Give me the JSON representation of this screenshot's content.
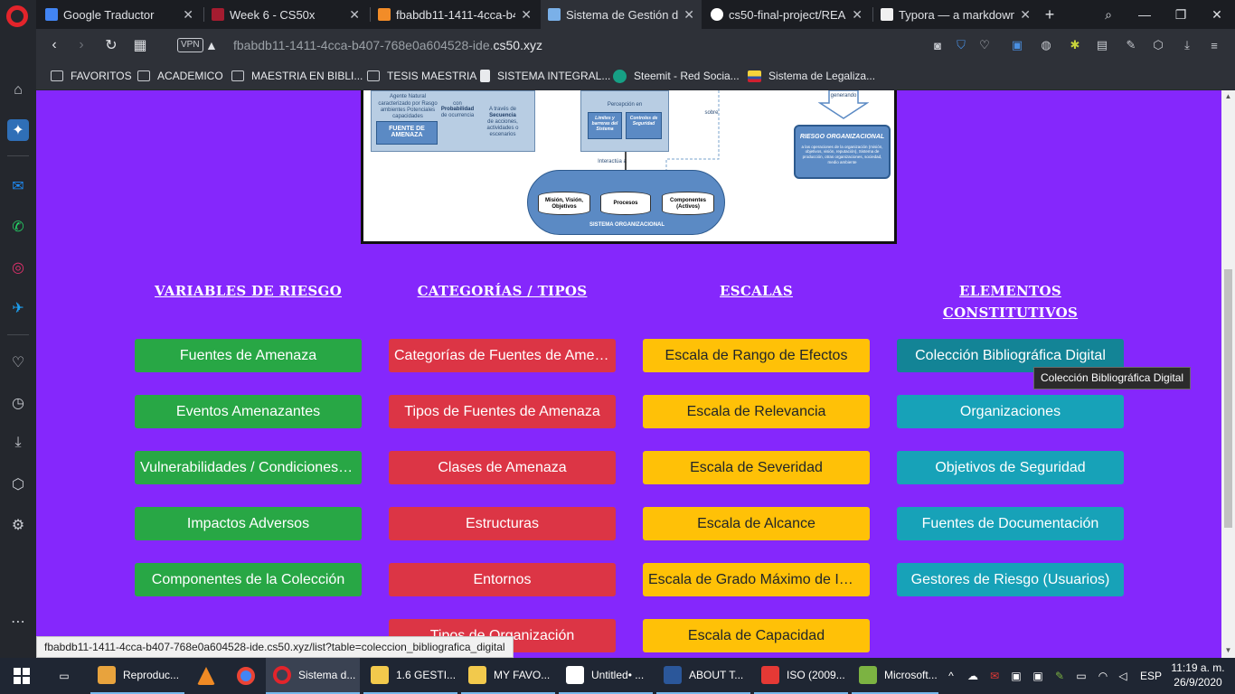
{
  "browser": {
    "tabs": [
      {
        "title": "Google Traductor",
        "favicon_color": "#4285f4"
      },
      {
        "title": "Week 6 - CS50x",
        "favicon_color": "#a51c30"
      },
      {
        "title": "fbabdb11-1411-4cca-b4",
        "favicon_color": "#f28c28"
      },
      {
        "title": "Sistema de Gestión de R",
        "favicon_color": "#7ab0e8"
      },
      {
        "title": "cs50-final-project/READI",
        "favicon_color": "#ffffff"
      },
      {
        "title": "Typora — a markdown e",
        "favicon_color": "#f0f0f0"
      }
    ],
    "new_tab_symbol": "+",
    "vpn_label": "VPN",
    "url_prefix": "fbabdb11-1411-4cca-b407-768e0a604528-ide.",
    "url_domain": "cs50.xyz",
    "bookmarks": [
      {
        "label": "FAVORITOS",
        "icon": "folder-icon"
      },
      {
        "label": "ACADEMICO",
        "icon": "folder-icon"
      },
      {
        "label": "MAESTRIA EN BIBLI...",
        "icon": "folder-icon"
      },
      {
        "label": "TESIS MAESTRIA",
        "icon": "folder-icon"
      },
      {
        "label": "SISTEMA INTEGRAL...",
        "icon": "document-icon"
      },
      {
        "label": "Steemit - Red Socia...",
        "icon": "steemit-icon"
      },
      {
        "label": "Sistema de Legaliza...",
        "icon": "flag-icon"
      }
    ]
  },
  "diagram": {
    "labels": {
      "agente": "Agente Natural",
      "caract": "caracterizado por Rasgo ambientes Potenciales capacidades",
      "fuente": "FUENTE DE AMENAZA",
      "prob_con": "con",
      "prob": "Probabilidad",
      "prob_sub": "de ocurrencia",
      "secuencia_pre": "A través de",
      "secuencia": "Secuencia",
      "secuencia_sub": "de acciones, actividades o escenarios",
      "percepcion": "Percepción en",
      "limites": "Límites y barreras del Sistema",
      "controles": "Controles de Seguridad",
      "controles_sub": "Protección / Contramedidas",
      "sobre": "sobre",
      "interactua": "Interactúa a",
      "genera": "generando",
      "mision": "Misión, Visión, Objetivos",
      "procesos": "Procesos",
      "componentes": "Componentes (Activos)",
      "sistema": "SISTEMA ORGANIZACIONAL",
      "riesgo_title": "RIESGO ORGANIZACIONAL",
      "riesgo_desc": "a las operaciones de la organización (misión, objetivos, visión, reputación), Sistema de producción, otras organizaciones, sociedad, medio ambiente"
    }
  },
  "sections": [
    {
      "heading": "VARIABLES DE RIESGO",
      "color": "green",
      "buttons": [
        "Fuentes de Amenaza",
        "Eventos Amenazantes",
        "Vulnerabilidades / Condiciones Predisponentes",
        "Impactos Adversos",
        "Componentes de la Colección"
      ]
    },
    {
      "heading": "CATEGORÍAS / TIPOS",
      "color": "red",
      "buttons": [
        "Categorías de Fuentes de Amenaza",
        "Tipos de Fuentes de Amenaza",
        "Clases de Amenaza",
        "Estructuras",
        "Entornos",
        "Tipos de Organización"
      ]
    },
    {
      "heading": "ESCALAS",
      "color": "yellow",
      "buttons": [
        "Escala de Rango de Efectos",
        "Escala de Relevancia",
        "Escala de Severidad",
        "Escala de Alcance",
        "Escala de Grado Máximo de Impacto",
        "Escala de Capacidad"
      ]
    },
    {
      "heading": "ELEMENTOS CONSTITUTIVOS",
      "color": "cyan",
      "buttons": [
        "Colección Bibliográfica Digital",
        "Organizaciones",
        "Objetivos de Seguridad",
        "Fuentes de Documentación",
        "Gestores de Riesgo (Usuarios)"
      ]
    }
  ],
  "tooltip": "Colección Bibliográfica Digital",
  "status_url": "fbabdb11-1411-4cca-b407-768e0a604528-ide.cs50.xyz/list?table=coleccion_bibliografica_digital",
  "taskbar": {
    "items": [
      {
        "label": "Reproduc...",
        "icon_color": "#e8a33d"
      },
      {
        "label": "",
        "icon_color": "#f08a24"
      },
      {
        "label": "",
        "icon_color": "#4285f4"
      },
      {
        "label": "Sistema d...",
        "icon_color": "#e3242b"
      },
      {
        "label": "1.6 GESTI...",
        "icon_color": "#f2c94c"
      },
      {
        "label": "MY FAVO...",
        "icon_color": "#f2c94c"
      },
      {
        "label": "Untitled• ...",
        "icon_color": "#ffffff"
      },
      {
        "label": "ABOUT T...",
        "icon_color": "#2b579a"
      },
      {
        "label": "ISO (2009...",
        "icon_color": "#e53935"
      },
      {
        "label": "Microsoft...",
        "icon_color": "#7cb342"
      }
    ],
    "language": "ESP",
    "time": "11:19 a. m.",
    "date": "26/9/2020"
  }
}
